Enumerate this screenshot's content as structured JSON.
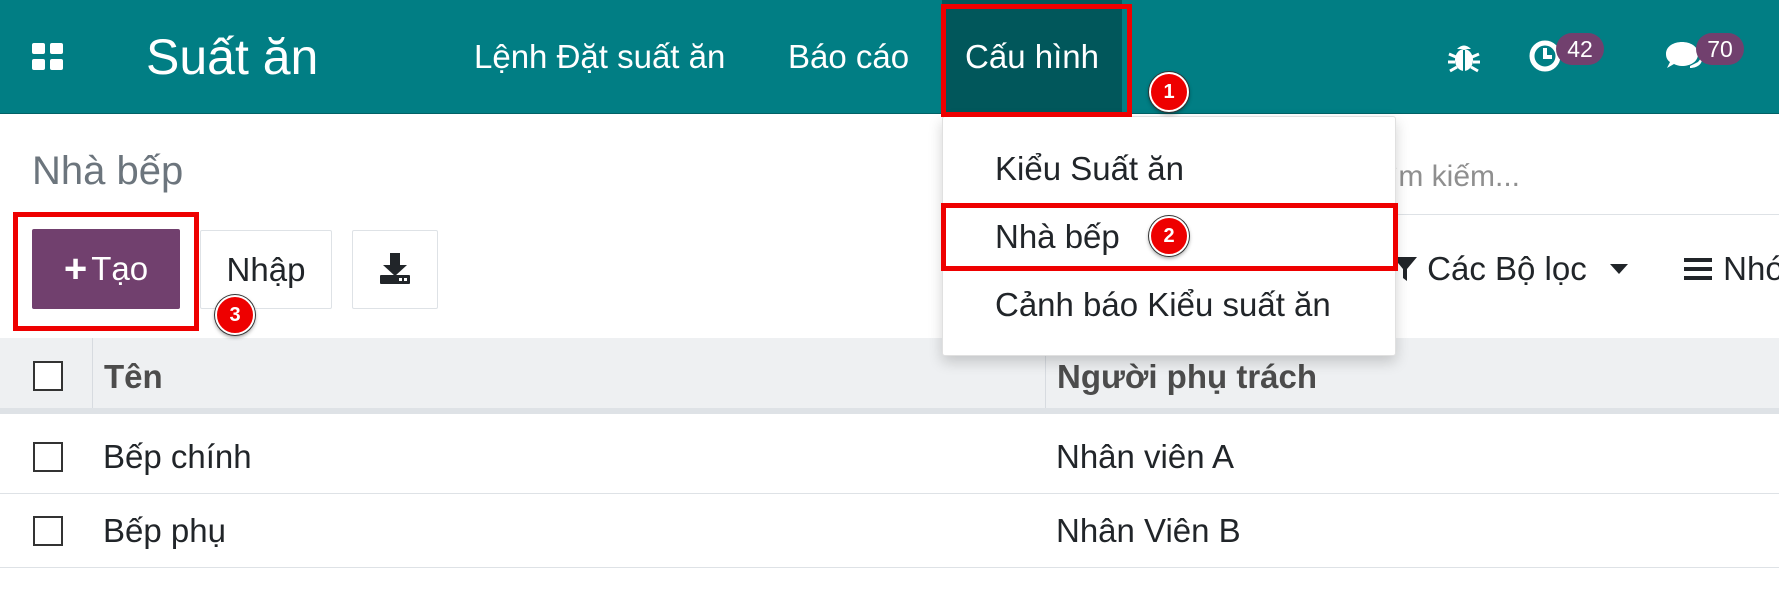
{
  "navbar": {
    "app_title": "Suất ăn",
    "menu": {
      "orders": "Lệnh Đặt suất ăn",
      "reports": "Báo cáo",
      "config": "Cấu hình"
    },
    "activity_count": "42",
    "messages_count": "70",
    "background_color": "#017e84",
    "active_color": "#01575b",
    "icons": [
      "apps-grid-icon",
      "bug-icon",
      "clock-icon",
      "chat-icon"
    ]
  },
  "config_menu": {
    "items": [
      "Kiểu Suất ăn",
      "Nhà bếp",
      "Cảnh báo Kiểu suất ăn"
    ]
  },
  "page": {
    "title": "Nhà bếp",
    "search_placeholder_fragment": "ìm kiếm...",
    "filters_label": "Các Bộ lọc",
    "group_label_fragment": "Nhó"
  },
  "buttons": {
    "create": "Tạo",
    "import": "Nhập",
    "primary_color": "#71406e"
  },
  "table": {
    "columns": [
      "Tên",
      "Người phụ trách"
    ],
    "rows": [
      {
        "name": "Bếp chính",
        "owner": "Nhân viên A"
      },
      {
        "name": "Bếp phụ",
        "owner": "Nhân Viên B"
      }
    ]
  },
  "annotations": {
    "labels": [
      "1",
      "2",
      "3"
    ],
    "color": "#ee0000"
  }
}
